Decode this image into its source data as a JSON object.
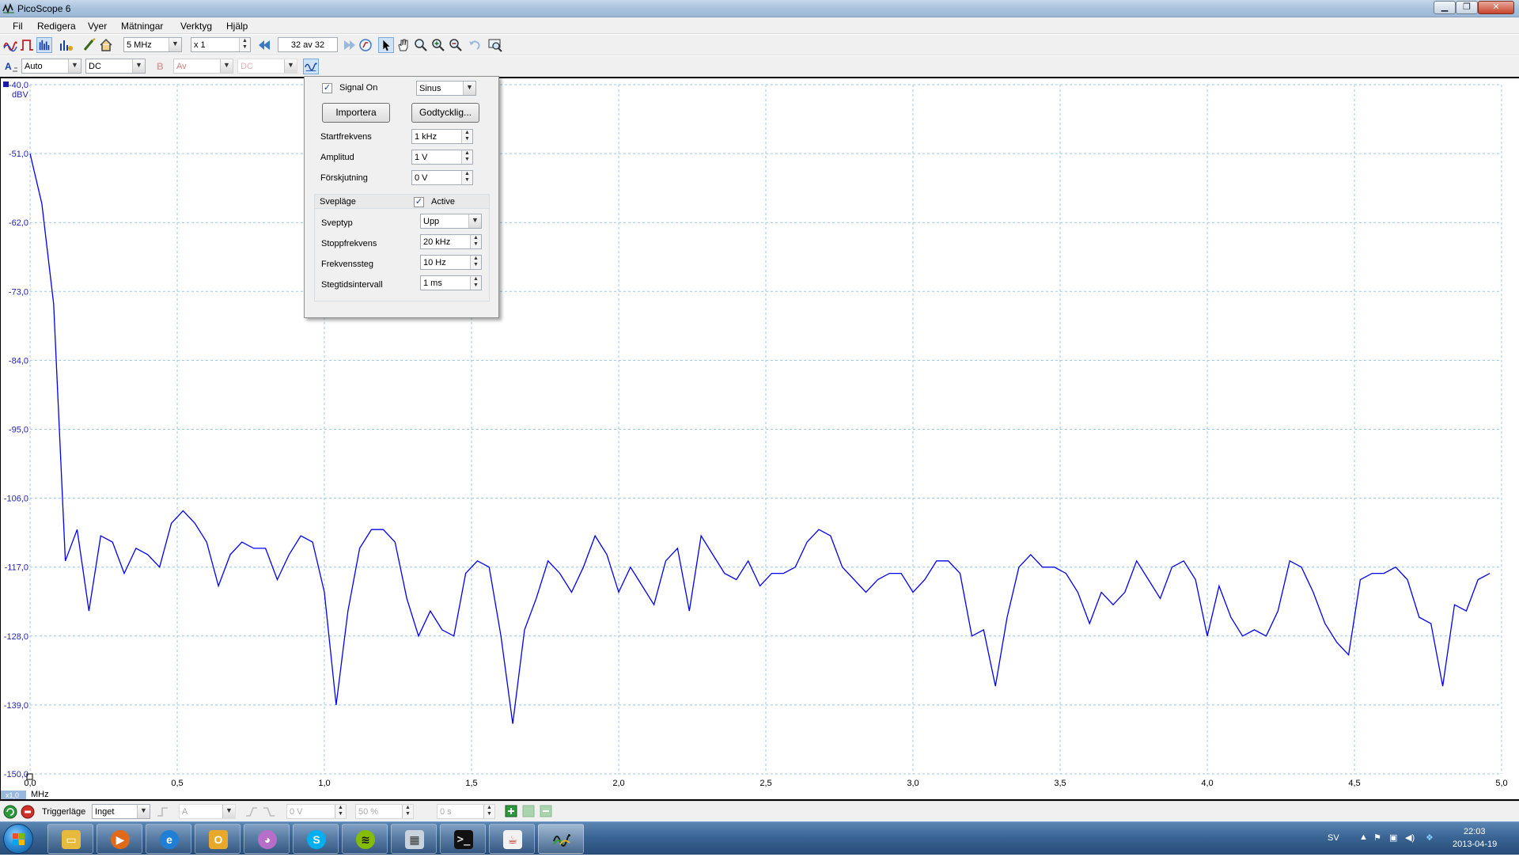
{
  "window": {
    "title": "PicoScope 6"
  },
  "menu": [
    "Fil",
    "Redigera",
    "Vyer",
    "Mätningar",
    "Verktyg",
    "Hjälp"
  ],
  "toolbar1": {
    "timebase": "5 MHz",
    "zoom": "x 1",
    "buffer": "32 av 32"
  },
  "toolbar2": {
    "channel_a_range": "Auto",
    "channel_a_coupling": "DC",
    "channel_b_range": "Av",
    "channel_b_coupling": "DC"
  },
  "siggen": {
    "signal_on_label": "Signal On",
    "signal_on_checked": true,
    "wave_type": "Sinus",
    "import_button": "Importera",
    "arbitrary_button": "Godtycklig...",
    "start_freq_label": "Startfrekvens",
    "start_freq_value": "1 kHz",
    "amplitude_label": "Amplitud",
    "amplitude_value": "1 V",
    "offset_label": "Förskjutning",
    "offset_value": "0 V",
    "sweep_mode_label": "Svepläge",
    "sweep_active_label": "Active",
    "sweep_active_checked": true,
    "sweep_type_label": "Sveptyp",
    "sweep_type_value": "Upp",
    "stop_freq_label": "Stoppfrekvens",
    "stop_freq_value": "20 kHz",
    "freq_step_label": "Frekvenssteg",
    "freq_step_value": "10 Hz",
    "step_interval_label": "Stegtidsintervall",
    "step_interval_value": "1 ms"
  },
  "plot": {
    "y_unit": "dBV",
    "x_unit": "MHz",
    "x_zoom_badge": "x1,0",
    "trace_color": "#0000ee"
  },
  "bottom": {
    "trigger_label": "Triggerläge",
    "trigger_mode": "Inget",
    "trigger_channel": "A",
    "threshold": "0 V",
    "pre_trigger": "50 %",
    "delay": "0 s"
  },
  "tray": {
    "language": "SV",
    "time": "22:03",
    "date": "2013-04-19"
  },
  "chart_data": {
    "type": "line",
    "xlabel": "MHz",
    "ylabel": "dBV",
    "xlim": [
      0,
      5.0
    ],
    "ylim": [
      -150,
      -40
    ],
    "grid": true,
    "x_ticks": [
      "0,0",
      "0,5",
      "1,0",
      "1,5",
      "2,0",
      "2,5",
      "3,0",
      "3,5",
      "4,0",
      "4,5",
      "5,0"
    ],
    "y_ticks": [
      "-40,0",
      "-51,0",
      "-62,0",
      "-73,0",
      "-84,0",
      "-95,0",
      "-106,0",
      "-117,0",
      "-128,0",
      "-139,0",
      "-150,0"
    ],
    "series": [
      {
        "x": [
          0.0,
          0.04,
          0.08,
          0.12,
          0.16,
          0.2,
          0.24,
          0.28,
          0.32,
          0.36,
          0.4,
          0.44,
          0.48,
          0.52,
          0.56,
          0.6,
          0.64,
          0.68,
          0.72,
          0.76,
          0.8,
          0.84,
          0.88,
          0.92,
          0.96,
          1.0,
          1.04,
          1.08,
          1.12,
          1.16,
          1.2,
          1.24,
          1.28,
          1.32,
          1.36,
          1.4,
          1.44,
          1.48,
          1.52,
          1.56,
          1.6,
          1.64,
          1.68,
          1.72,
          1.76,
          1.8,
          1.84,
          1.88,
          1.92,
          1.96,
          2.0,
          2.04,
          2.08,
          2.12,
          2.16,
          2.2,
          2.24,
          2.28,
          2.32,
          2.36,
          2.4,
          2.44,
          2.48,
          2.52,
          2.56,
          2.6,
          2.64,
          2.68,
          2.72,
          2.76,
          2.8,
          2.84,
          2.88,
          2.92,
          2.96,
          3.0,
          3.04,
          3.08,
          3.12,
          3.16,
          3.2,
          3.24,
          3.28,
          3.32,
          3.36,
          3.4,
          3.44,
          3.48,
          3.52,
          3.56,
          3.6,
          3.64,
          3.68,
          3.72,
          3.76,
          3.8,
          3.84,
          3.88,
          3.92,
          3.96,
          4.0,
          4.04,
          4.08,
          4.12,
          4.16,
          4.2,
          4.24,
          4.28,
          4.32,
          4.36,
          4.4,
          4.44,
          4.48,
          4.52,
          4.56,
          4.6,
          4.64,
          4.68,
          4.72,
          4.76,
          4.8,
          4.84,
          4.88,
          4.92,
          4.96
        ],
        "y": [
          -51,
          -59,
          -75,
          -116,
          -111,
          -124,
          -112,
          -113,
          -118,
          -114,
          -115,
          -117,
          -110,
          -108,
          -110,
          -113,
          -120,
          -115,
          -113,
          -114,
          -114,
          -119,
          -115,
          -112,
          -113,
          -121,
          -139,
          -124,
          -114,
          -111,
          -111,
          -113,
          -122,
          -128,
          -124,
          -127,
          -128,
          -118,
          -116,
          -117,
          -128,
          -142,
          -127,
          -122,
          -116,
          -118,
          -121,
          -117,
          -112,
          -115,
          -121,
          -117,
          -120,
          -123,
          -116,
          -114,
          -124,
          -112,
          -115,
          -118,
          -119,
          -116,
          -120,
          -118,
          -118,
          -117,
          -113,
          -111,
          -112,
          -117,
          -119,
          -121,
          -119,
          -118,
          -118,
          -121,
          -119,
          -116,
          -116,
          -118,
          -128,
          -127,
          -136,
          -125,
          -117,
          -115,
          -117,
          -117,
          -118,
          -121,
          -126,
          -121,
          -123,
          -121,
          -116,
          -119,
          -122,
          -117,
          -116,
          -119,
          -128,
          -120,
          -125,
          -128,
          -127,
          -128,
          -124,
          -116,
          -117,
          -121,
          -126,
          -129,
          -131,
          -119,
          -118,
          -118,
          -117,
          -119,
          -125,
          -126,
          -136,
          -123,
          -124,
          -119,
          -118
        ]
      }
    ]
  }
}
